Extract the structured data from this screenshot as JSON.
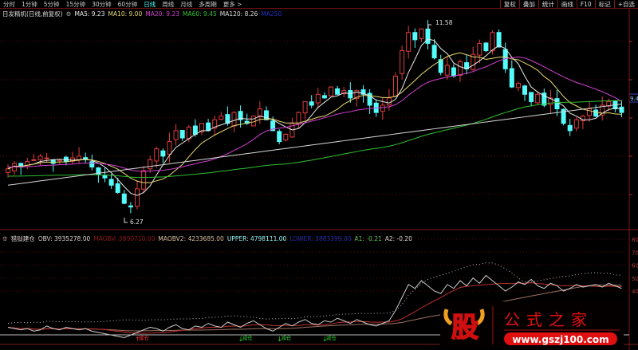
{
  "toolbar": {
    "timeframes": [
      "分时",
      "1分钟",
      "5分钟",
      "15分钟",
      "30分钟",
      "60分钟",
      "日线",
      "周线",
      "月线",
      "多周期",
      "更多 >"
    ],
    "active": "日线",
    "right_buttons": [
      "复权",
      "叠加",
      "统计",
      "画线",
      "F10",
      "标记",
      "+自选"
    ]
  },
  "legend": {
    "title": "日发精机(日线,前复权)",
    "ma5": "MA5: 9.23",
    "ma10": "MA10: 9.00",
    "ma20": "MA20: 9.23",
    "ma60": "MA60: 9.45",
    "ma120": "MA120: 8.26",
    "ma250": "MA250"
  },
  "indicator_legend": {
    "title": "猎狱建仓",
    "obv": "OBV: 3935278.00",
    "maobv": "MAOBV: 3890710.00",
    "maobv2": "MAOBV2: 4233685.00",
    "upper": "UPPER: 4798111.00",
    "lower": "LOWER: 3883399.00",
    "a1": "A1: -0.21",
    "a2": "A2: -0.20"
  },
  "colors": {
    "up": "#e03c3c",
    "down": "#54fcfc",
    "ma5": "#e8e8e8",
    "ma10": "#e8d870",
    "ma20": "#d040d0",
    "ma60": "#30c030",
    "ma120": "#d8d8d8",
    "maobv": "#c03030",
    "maobv2": "#a07060",
    "grid": "#5a0a0a"
  },
  "chart_data": {
    "type": "candlestick",
    "price_high_label": "11.58",
    "price_low_label": "6.27",
    "last_price_label": "9.4",
    "closes": [
      7.55,
      7.7,
      7.6,
      7.75,
      7.8,
      7.9,
      7.85,
      7.7,
      7.8,
      7.75,
      7.85,
      7.9,
      7.8,
      7.6,
      7.4,
      7.3,
      7.1,
      6.9,
      6.6,
      6.5,
      7.0,
      7.5,
      7.8,
      8.1,
      7.9,
      8.3,
      8.6,
      8.4,
      8.7,
      8.5,
      8.8,
      8.6,
      8.9,
      9.0,
      8.8,
      9.1,
      8.9,
      8.8,
      9.0,
      9.2,
      8.9,
      8.6,
      8.3,
      8.5,
      8.8,
      9.1,
      9.4,
      9.3,
      9.6,
      9.5,
      9.8,
      9.6,
      9.7,
      9.5,
      9.7,
      9.6,
      9.3,
      9.1,
      9.3,
      9.5,
      10.1,
      10.8,
      11.3,
      11.1,
      11.4,
      11.0,
      10.6,
      10.2,
      10.4,
      10.1,
      10.5,
      10.3,
      10.7,
      11.0,
      10.8,
      11.3,
      10.9,
      10.3,
      9.8,
      9.9,
      9.6,
      9.4,
      9.6,
      9.3,
      9.5,
      9.2,
      8.8,
      8.6,
      8.9,
      9.0,
      9.2,
      9.0,
      9.3,
      9.4,
      9.2,
      9.1
    ],
    "price_range": [
      6.27,
      11.58
    ],
    "indicator": {
      "obv": [
        12,
        11,
        10,
        11,
        9,
        10,
        13,
        11,
        10,
        12,
        11,
        10,
        11,
        9,
        8,
        7,
        6,
        5,
        4,
        6,
        8,
        10,
        12,
        11,
        9,
        12,
        14,
        11,
        10,
        13,
        12,
        15,
        13,
        12,
        16,
        14,
        12,
        15,
        17,
        14,
        11,
        9,
        12,
        15,
        13,
        16,
        18,
        15,
        14,
        17,
        16,
        19,
        17,
        15,
        18,
        16,
        14,
        13,
        15,
        17,
        25,
        35,
        45,
        42,
        48,
        44,
        40,
        38,
        45,
        42,
        48,
        44,
        50,
        46,
        52,
        48,
        44,
        40,
        43,
        47,
        45,
        49,
        44,
        42,
        46,
        44,
        40,
        42,
        45,
        43,
        44,
        45,
        43,
        46,
        44,
        42
      ],
      "yticks": [
        "80",
        "70",
        "60",
        "50",
        "40"
      ],
      "range": [
        0,
        80
      ],
      "signals": [
        {
          "index": 20,
          "label": "建仓",
          "type": "buy"
        },
        {
          "index": 36,
          "label": "减仓",
          "type": "sell"
        },
        {
          "index": 42,
          "label": "减仓",
          "type": "sell"
        },
        {
          "index": 49,
          "label": "减仓",
          "type": "sell"
        }
      ]
    }
  },
  "watermark": {
    "logo_char": "股",
    "name": "公式之家",
    "url": "www.gszj100.com"
  }
}
